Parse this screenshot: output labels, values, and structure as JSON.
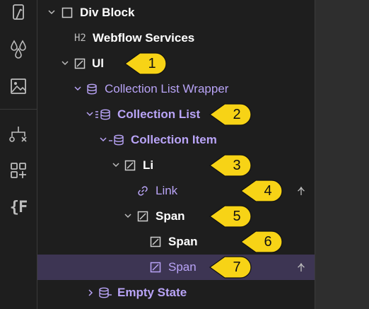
{
  "icons": {
    "rail": [
      "style-brush-icon",
      "color-drops-icon",
      "image-icon",
      "component-tree-icon",
      "add-elements-icon",
      "variables-icon"
    ],
    "row_types": [
      "square-icon",
      "heading-tag",
      "box-slash-icon",
      "database-icon",
      "database-list-icon",
      "database-item-icon",
      "link-icon",
      "pin-icon"
    ]
  },
  "rail": {
    "variables_glyph": "{F"
  },
  "tree": {
    "rows": [
      {
        "label": "Div Block"
      },
      {
        "label": "Webflow Services",
        "tag": "H2"
      },
      {
        "label": "Ul"
      },
      {
        "label": "Collection List Wrapper"
      },
      {
        "label": "Collection List"
      },
      {
        "label": "Collection Item"
      },
      {
        "label": "Li"
      },
      {
        "label": "Link"
      },
      {
        "label": "Span"
      },
      {
        "label": "Span"
      },
      {
        "label": "Span"
      },
      {
        "label": "Empty State"
      }
    ]
  },
  "callouts": [
    "1",
    "2",
    "3",
    "4",
    "5",
    "6",
    "7"
  ],
  "colors": {
    "accent_purple": "#b9a4f7",
    "selected_row": "#3d3553",
    "callout_yellow": "#f7d316"
  }
}
